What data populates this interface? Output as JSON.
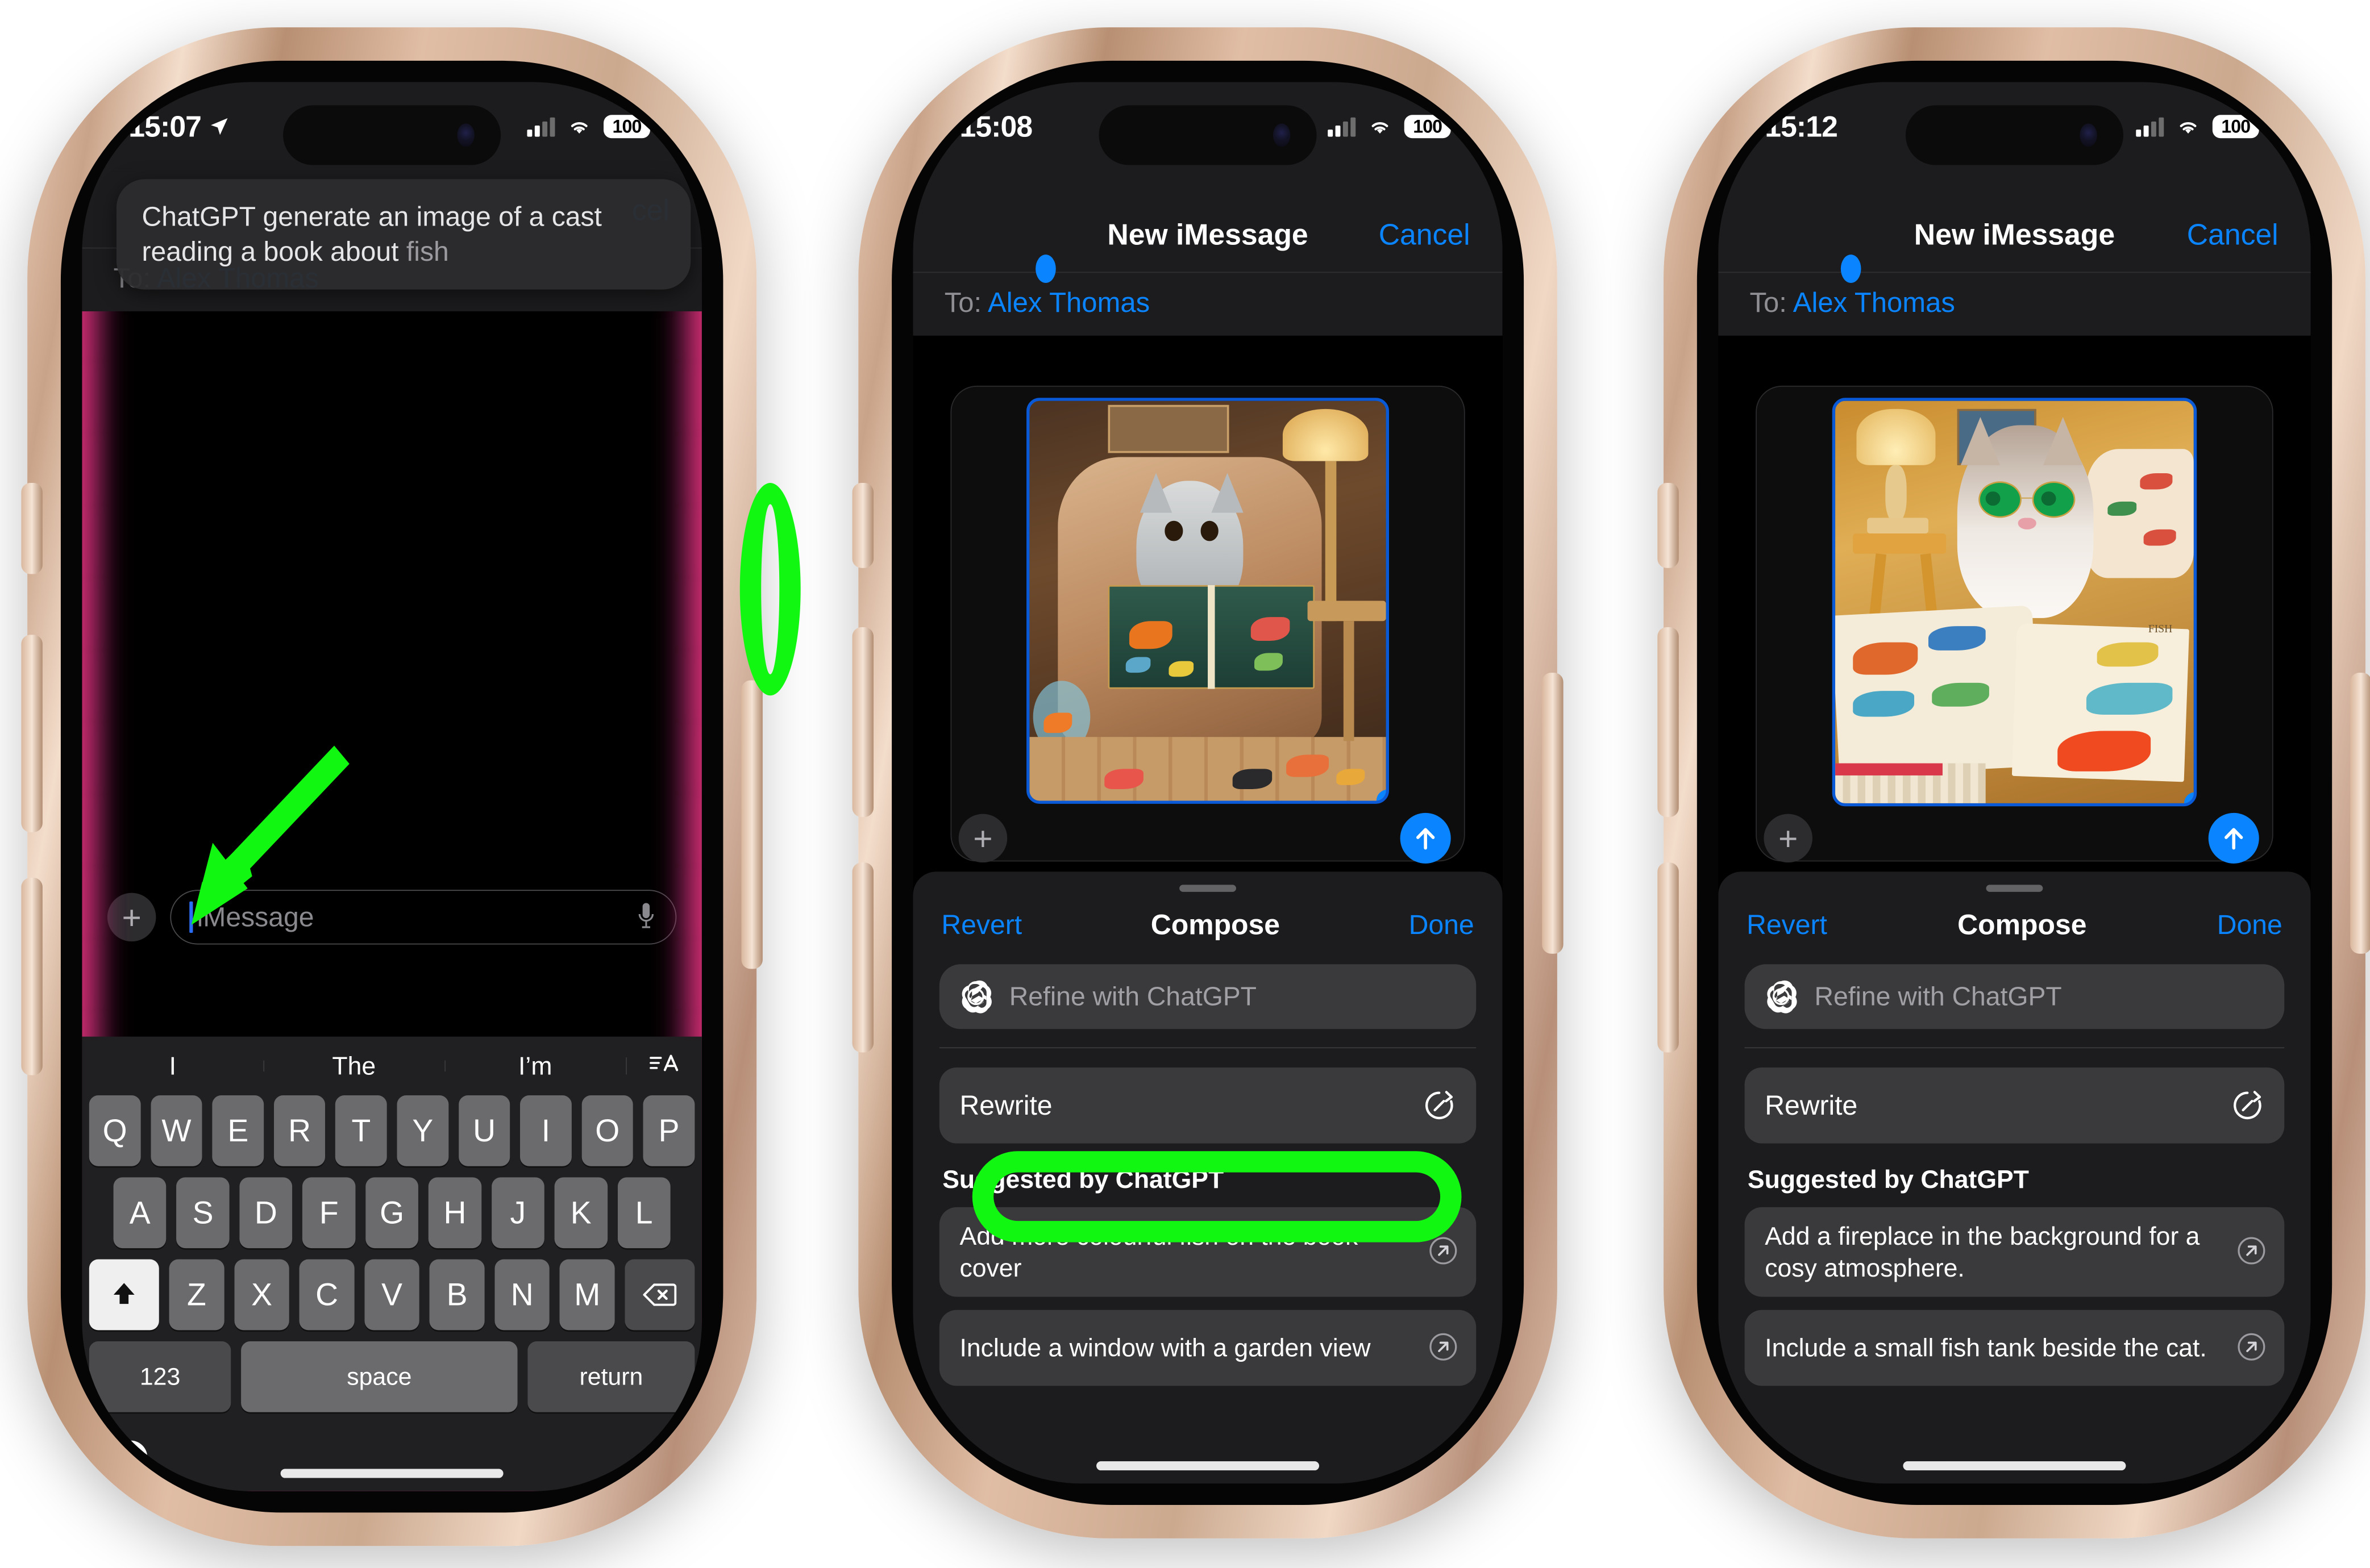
{
  "phones": [
    {
      "id": "phone-1",
      "status": {
        "time": "15:07",
        "location_arrow": true,
        "battery": "100",
        "wifi": "wifi-icon",
        "cellular": "cellular-icon"
      },
      "siri_banner": {
        "line1": "ChatGPT generate an image of a cast",
        "line2_visible": "reading a book about ",
        "line2_dim": "fish"
      },
      "nav": {
        "cancel": "cel"
      },
      "recipient": {
        "label": "To:",
        "name": "Alex Thomas"
      },
      "input": {
        "placeholder": "iMessage",
        "plus": "+",
        "mic": "mic-icon"
      },
      "keyboard": {
        "suggestions": [
          "I",
          "The",
          "I’m"
        ],
        "format_icon": "text-format-icon",
        "row1": [
          "Q",
          "W",
          "E",
          "R",
          "T",
          "Y",
          "U",
          "I",
          "O",
          "P"
        ],
        "row2": [
          "A",
          "S",
          "D",
          "F",
          "G",
          "H",
          "J",
          "K",
          "L"
        ],
        "row3": [
          "Z",
          "X",
          "C",
          "V",
          "B",
          "N",
          "M"
        ],
        "shift": "shift-icon",
        "backspace": "backspace-icon",
        "numbers": "123",
        "space": "space",
        "return": "return",
        "emoji": "emoji-icon",
        "dictation": "mic-icon"
      },
      "annotations": {
        "arrow": "green-arrow-to-message-field",
        "ring": "green-oval-on-side-button"
      }
    },
    {
      "id": "phone-2",
      "status": {
        "time": "15:08",
        "location_arrow": false,
        "battery": "100",
        "wifi": "wifi-icon",
        "cellular": "cellular-icon"
      },
      "nav": {
        "title": "New iMessage",
        "cancel": "Cancel"
      },
      "recipient": {
        "label": "To:",
        "name": "Alex Thomas"
      },
      "attachment": {
        "alt": "AI generated image of a tabby cat in an armchair reading a book about fish",
        "plus": "+",
        "send": "send-arrow-icon"
      },
      "compose": {
        "revert": "Revert",
        "title": "Compose",
        "done": "Done",
        "refine_placeholder": "Refine with ChatGPT",
        "openai_icon": "openai-logo-icon",
        "rewrite_label": "Rewrite",
        "rewrite_icon": "rewrite-dial-icon",
        "suggested_header": "Suggested by ChatGPT",
        "suggestions": [
          "Add more colourful fish on the book cover",
          "Include a window with a garden view"
        ]
      },
      "annotations": {
        "box": "green-box-around-rewrite-row"
      }
    },
    {
      "id": "phone-3",
      "status": {
        "time": "15:12",
        "location_arrow": false,
        "battery": "100",
        "wifi": "wifi-icon",
        "cellular": "cellular-icon"
      },
      "nav": {
        "title": "New iMessage",
        "cancel": "Cancel"
      },
      "recipient": {
        "label": "To:",
        "name": "Alex Thomas"
      },
      "attachment": {
        "alt": "AI generated image of a fluffy cat with round glasses beside an open book of colourful fish",
        "plus": "+",
        "send": "send-arrow-icon"
      },
      "compose": {
        "revert": "Revert",
        "title": "Compose",
        "done": "Done",
        "refine_placeholder": "Refine with ChatGPT",
        "openai_icon": "openai-logo-icon",
        "rewrite_label": "Rewrite",
        "rewrite_icon": "rewrite-dial-icon",
        "suggested_header": "Suggested by ChatGPT",
        "suggestions": [
          "Add a fireplace in the background for a cosy atmosphere.",
          "Include a small fish tank beside the cat."
        ]
      },
      "annotations": {}
    }
  ],
  "colors": {
    "accent_blue": "#0a84ff",
    "annotation_green": "#12f712",
    "sheet_bg": "#1c1c1e",
    "field_bg": "#3a3a3c",
    "key_bg": "#6b6b6e",
    "text_secondary": "#8e8e93"
  }
}
